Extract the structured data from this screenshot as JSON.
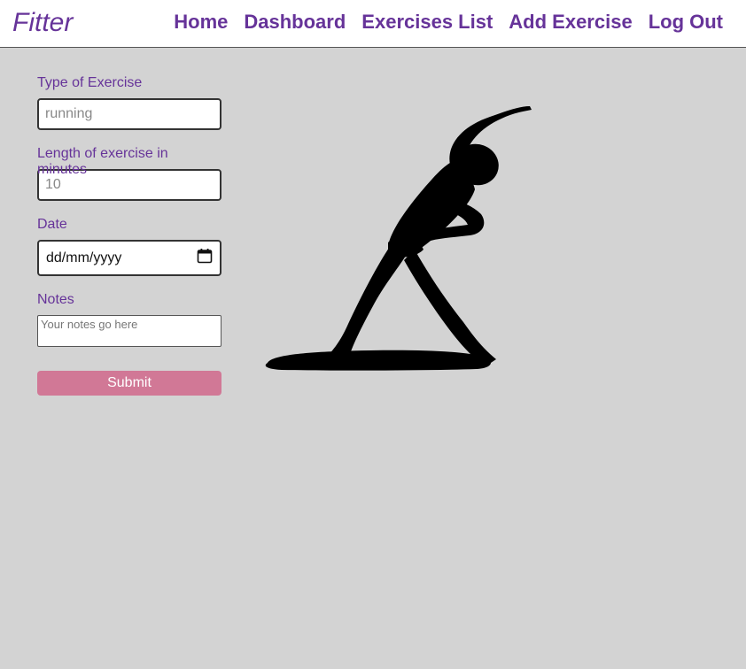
{
  "nav": {
    "brand": "Fitter",
    "links": [
      "Home",
      "Dashboard",
      "Exercises List",
      "Add Exercise",
      "Log Out"
    ]
  },
  "form": {
    "type_label": "Type of Exercise",
    "type_placeholder": "running",
    "length_label": "Length of exercise in minutes",
    "length_placeholder": "10",
    "date_label": "Date",
    "date_placeholder": "dd/mm/yyyy",
    "date_icon": "calendar-icon",
    "notes_label": "Notes",
    "notes_placeholder": "Your notes go here",
    "submit_label": "Submit"
  },
  "illustration": {
    "icon": "stretching-person-silhouette"
  },
  "colors": {
    "accent": "#663399",
    "submit": "#d17896",
    "background": "#d3d3d3"
  }
}
